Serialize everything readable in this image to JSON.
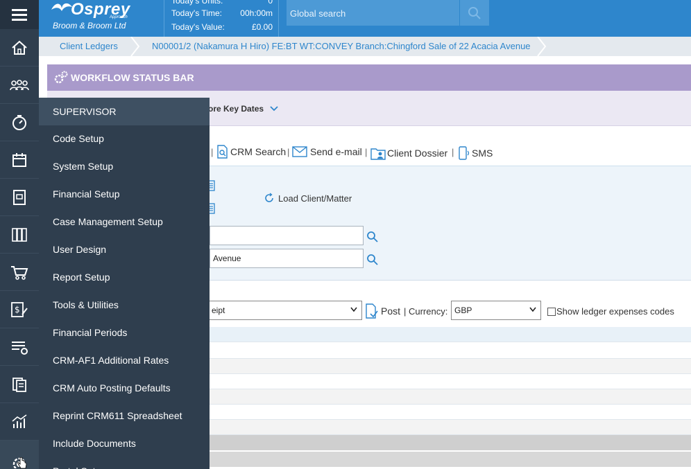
{
  "header": {
    "brand": "Osprey",
    "brand_sub": "Approach",
    "firm": "Broom & Broom Ltd",
    "stats": [
      {
        "label": "Today's Units:",
        "value": "0"
      },
      {
        "label": "Today's Time:",
        "value": "00h:00m"
      },
      {
        "label": "Today's Value:",
        "value": "£0.00"
      }
    ],
    "search_placeholder": "Global search",
    "accent": "#2e86cc"
  },
  "rail_icons": [
    "home-icon",
    "clients-icon",
    "timer-icon",
    "calendar-icon",
    "ledger-book-icon",
    "library-icon",
    "shopping-cart-icon",
    "finance-edit-icon",
    "list-settings-icon",
    "documents-icon",
    "analytics-chart-icon",
    "settings-gear-icon"
  ],
  "breadcrumb": {
    "items": [
      "Client Ledgers",
      "N00001/2 (Nakamura H Hiro) FE:BT WT:CONVEY Branch:Chingford Sale of 22 Acacia Avenue"
    ]
  },
  "workflow": {
    "title": "WORKFLOW STATUS BAR",
    "key_dates": "ore Key Dates"
  },
  "toolbar": {
    "crm_search": "CRM Search",
    "send_email": "Send e-mail",
    "client_dossier": "Client Dossier",
    "sms": "SMS",
    "separator": "|"
  },
  "client_panel": {
    "load_label": "Load Client/Matter",
    "client_value": "",
    "matter_value": "Avenue"
  },
  "posting": {
    "type_value": "eipt",
    "post_label": "Post",
    "currency_label": "| Currency:",
    "currency_value": "GBP",
    "show_expenses_label": "Show ledger expenses codes"
  },
  "menu": {
    "header": "SUPERVISOR",
    "items": [
      "Code Setup",
      "System Setup",
      "Financial Setup",
      "Case Management Setup",
      "User Design",
      "Report Setup",
      "Tools & Utilities",
      "Financial Periods",
      "CRM-AF1 Additional Rates",
      "CRM Auto Posting Defaults",
      "Reprint CRM611 Spreadsheet",
      "Include Documents",
      "Portal Setup"
    ]
  }
}
